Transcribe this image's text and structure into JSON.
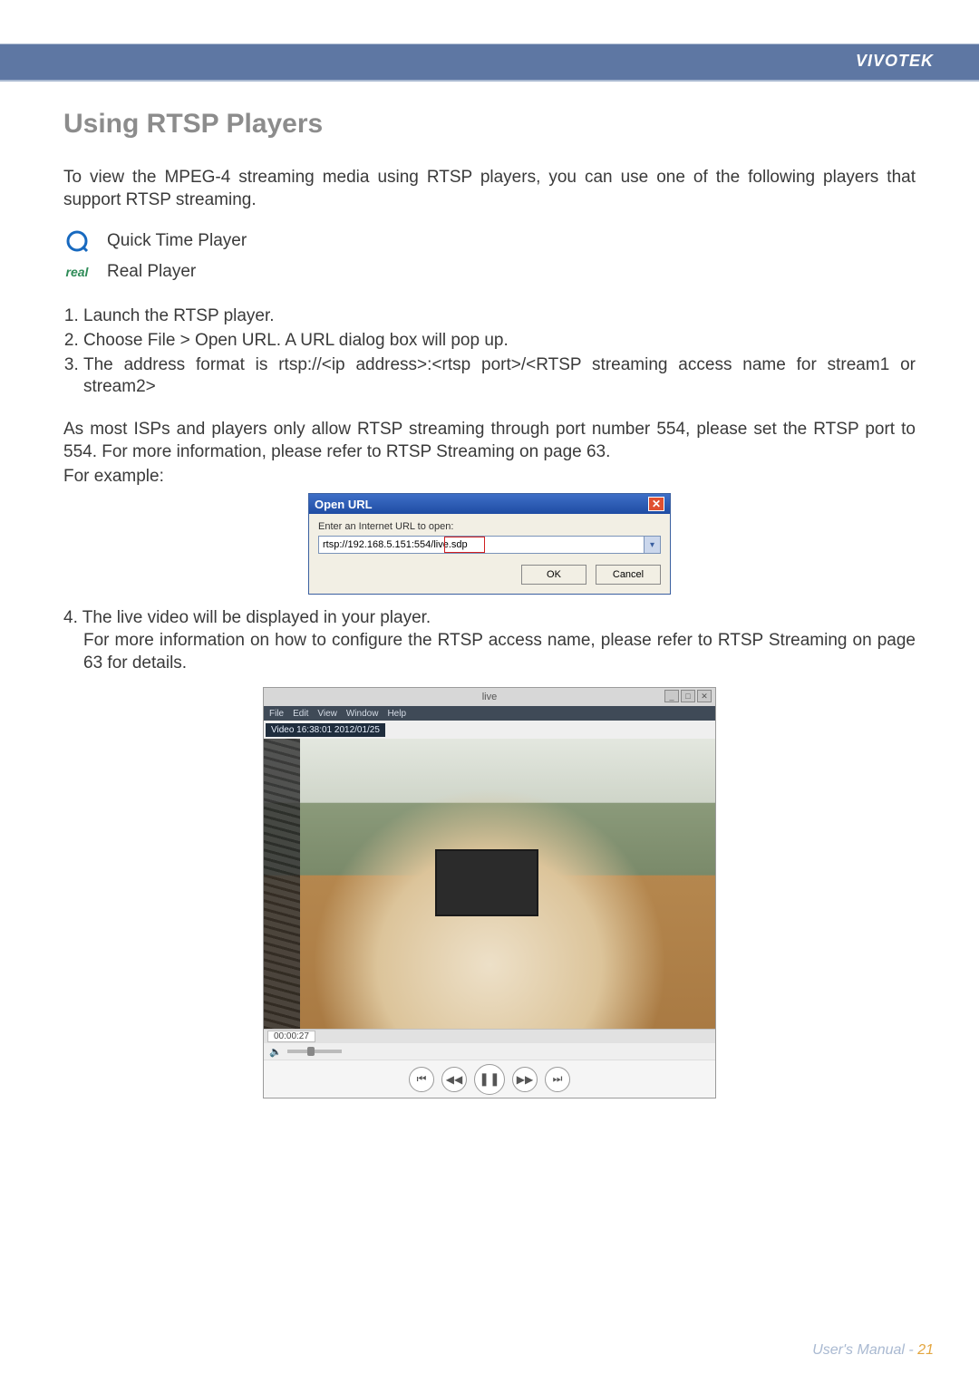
{
  "brand": "VIVOTEK",
  "section_title": "Using RTSP Players",
  "intro": "To view the MPEG-4 streaming media using RTSP players, you can use one of the following players that support RTSP streaming.",
  "players": {
    "qt": "Quick Time Player",
    "real": "Real Player"
  },
  "steps": {
    "s1": "Launch the RTSP player.",
    "s2": "Choose File > Open URL. A URL dialog box will pop up.",
    "s3": "The address format is rtsp://<ip address>:<rtsp port>/<RTSP streaming access name for stream1 or stream2>"
  },
  "isp_note": "As most ISPs and players only allow RTSP streaming through port number 554, please set the RTSP port to 554. For more information, please refer to RTSP Streaming on page 63.",
  "for_example": "For example:",
  "open_url_dialog": {
    "title": "Open URL",
    "label": "Enter an Internet URL to open:",
    "value": "rtsp://192.168.5.151:554/live.sdp",
    "ok": "OK",
    "cancel": "Cancel"
  },
  "step4": {
    "lead": "4. The live video will be displayed in your player.",
    "sub": "For more information on how to configure the RTSP access name, please refer to RTSP Streaming on page 63 for details."
  },
  "player_window": {
    "title": "live",
    "menu": [
      "File",
      "Edit",
      "View",
      "Window",
      "Help"
    ],
    "overlay": "Video 16:38:01 2012/01/25",
    "time": "00:00:27"
  },
  "footer": {
    "label": "User's Manual - ",
    "page": "21"
  }
}
